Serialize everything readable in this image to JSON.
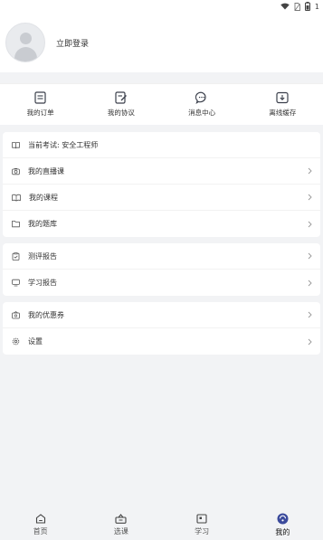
{
  "status_bar": {
    "battery_text": "1"
  },
  "profile": {
    "login_label": "立即登录"
  },
  "quick_actions": [
    {
      "label": "我的订单",
      "icon": "order-icon"
    },
    {
      "label": "我的协议",
      "icon": "agreement-icon"
    },
    {
      "label": "消息中心",
      "icon": "message-icon"
    },
    {
      "label": "离线缓存",
      "icon": "download-icon"
    }
  ],
  "menu": {
    "current_exam": {
      "prefix": "当前考试:",
      "value": "安全工程师",
      "icon": "book-icon"
    },
    "live_course": {
      "label": "我的直播课",
      "icon": "camera-icon"
    },
    "my_course": {
      "label": "我的课程",
      "icon": "open-book-icon"
    },
    "question_bank": {
      "label": "我的题库",
      "icon": "folder-icon"
    },
    "evaluation_report": {
      "label": "测评报告",
      "icon": "clipboard-icon"
    },
    "study_report": {
      "label": "学习报告",
      "icon": "monitor-icon"
    },
    "coupons": {
      "label": "我的优惠券",
      "icon": "coupon-icon"
    },
    "settings": {
      "label": "设置",
      "icon": "gear-icon"
    }
  },
  "tabbar": [
    {
      "label": "首页",
      "icon": "home-icon"
    },
    {
      "label": "选课",
      "icon": "basket-icon"
    },
    {
      "label": "学习",
      "icon": "study-icon"
    },
    {
      "label": "我的",
      "icon": "profile-icon",
      "active": true
    }
  ],
  "colors": {
    "background": "#f2f3f5",
    "card": "#ffffff",
    "text": "#333333",
    "active_tab": "#3b4a9c"
  }
}
